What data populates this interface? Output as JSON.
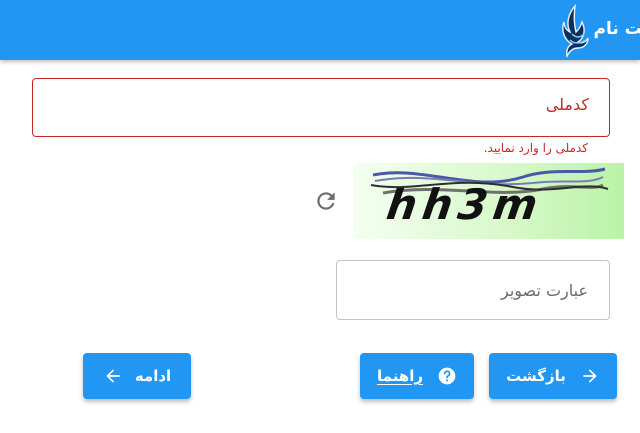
{
  "header": {
    "title": "ثبت نام",
    "logo_icon": "bird-logo-icon",
    "background_color": "#2196f3"
  },
  "form": {
    "national_code": {
      "label": "کدملی",
      "value": "",
      "error": "کدملی را وارد نمایید."
    },
    "captcha": {
      "image_text": "hh3m",
      "refresh_icon": "refresh-icon",
      "input_placeholder": "عبارت تصویر",
      "input_value": ""
    }
  },
  "buttons": {
    "back": {
      "label": "بازگشت",
      "icon": "arrow-right-icon"
    },
    "help": {
      "label": "راهنما",
      "icon": "help-circle-icon"
    },
    "continue": {
      "label": "ادامه",
      "icon": "arrow-left-icon"
    }
  },
  "colors": {
    "primary": "#2196f3",
    "error": "#c62828"
  }
}
